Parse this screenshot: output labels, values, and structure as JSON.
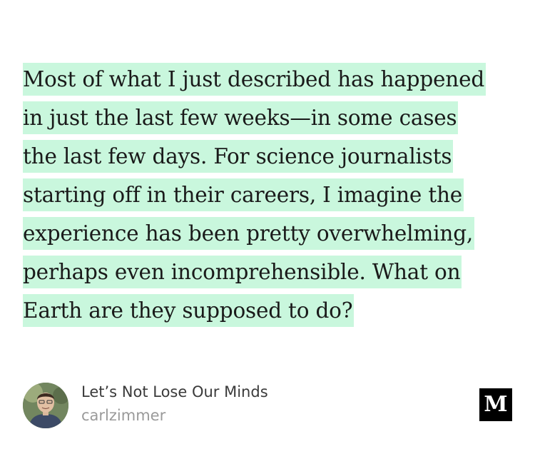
{
  "quote": {
    "lines": [
      "Most of what I just described has happened",
      "in just the last few weeks—in some cases",
      "the last few days. For science journalists",
      "starting off in their careers, I imagine the",
      "experience has been pretty overwhelming,",
      "perhaps even incomprehensible. What on",
      "Earth are they supposed to do?"
    ],
    "highlight_color": "#c9f7dd"
  },
  "footer": {
    "title": "Let’s Not Lose Our Minds",
    "author": "carlzimmer",
    "logo_letter": "M",
    "avatar_icon": "author-photo"
  }
}
